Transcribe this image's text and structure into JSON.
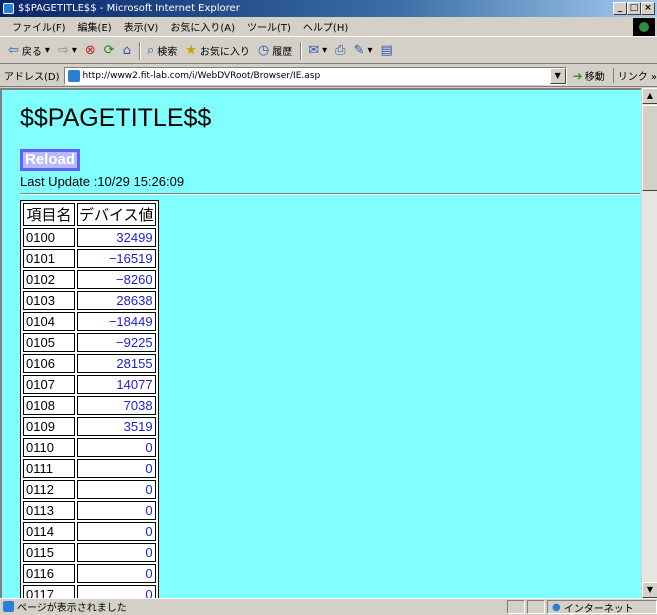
{
  "window": {
    "title": "$$PAGETITLE$$ - Microsoft Internet Explorer",
    "minimize_label": "_",
    "maximize_label": "□",
    "close_label": "×"
  },
  "menubar": {
    "items": [
      "ファイル(F)",
      "編集(E)",
      "表示(V)",
      "お気に入り(A)",
      "ツール(T)",
      "ヘルプ(H)"
    ]
  },
  "toolbar": {
    "back_label": "戻る",
    "back_glyph": "⇦",
    "forward_glyph": "⇨",
    "stop_glyph": "⊗",
    "refresh_glyph": "⟳",
    "home_glyph": "⌂",
    "search_label": "検索",
    "search_glyph": "⌕",
    "favorites_label": "お気に入り",
    "favorites_glyph": "★",
    "history_label": "履歴",
    "history_glyph": "◷",
    "mail_glyph": "✉",
    "print_glyph": "⎙",
    "edit_glyph": "✎",
    "discuss_glyph": "▤"
  },
  "addressbar": {
    "label": "アドレス(D)",
    "url": "http://www2.fit-lab.com/i/WebDVRoot/Browser/IE.asp",
    "dropdown_glyph": "▼",
    "go_label": "移動",
    "go_glyph": "➜",
    "links_label": "リンク »"
  },
  "page": {
    "title": "$$PAGETITLE$$",
    "reload_label": "Reload",
    "last_update": "Last Update :10/29 15:26:09"
  },
  "table": {
    "headers": [
      "項目名",
      "デバイス値"
    ],
    "rows": [
      {
        "name": "0100",
        "value": "32499"
      },
      {
        "name": "0101",
        "value": "−16519"
      },
      {
        "name": "0102",
        "value": "−8260"
      },
      {
        "name": "0103",
        "value": "28638"
      },
      {
        "name": "0104",
        "value": "−18449"
      },
      {
        "name": "0105",
        "value": "−9225"
      },
      {
        "name": "0106",
        "value": "28155"
      },
      {
        "name": "0107",
        "value": "14077"
      },
      {
        "name": "0108",
        "value": "7038"
      },
      {
        "name": "0109",
        "value": "3519"
      },
      {
        "name": "0110",
        "value": "0"
      },
      {
        "name": "0111",
        "value": "0"
      },
      {
        "name": "0112",
        "value": "0"
      },
      {
        "name": "0113",
        "value": "0"
      },
      {
        "name": "0114",
        "value": "0"
      },
      {
        "name": "0115",
        "value": "0"
      },
      {
        "name": "0116",
        "value": "0"
      },
      {
        "name": "0117",
        "value": "0"
      }
    ]
  },
  "scrollbar": {
    "up_glyph": "▲",
    "down_glyph": "▼"
  },
  "statusbar": {
    "text": "ページが表示されました",
    "zone_label": "インターネット",
    "zone_glyph": "●"
  },
  "colors": {
    "page_background": "#80ffff",
    "value_text": "#2020d0",
    "reload_button_bg": "#b8b8ff",
    "reload_button_border": "#6060ff"
  }
}
